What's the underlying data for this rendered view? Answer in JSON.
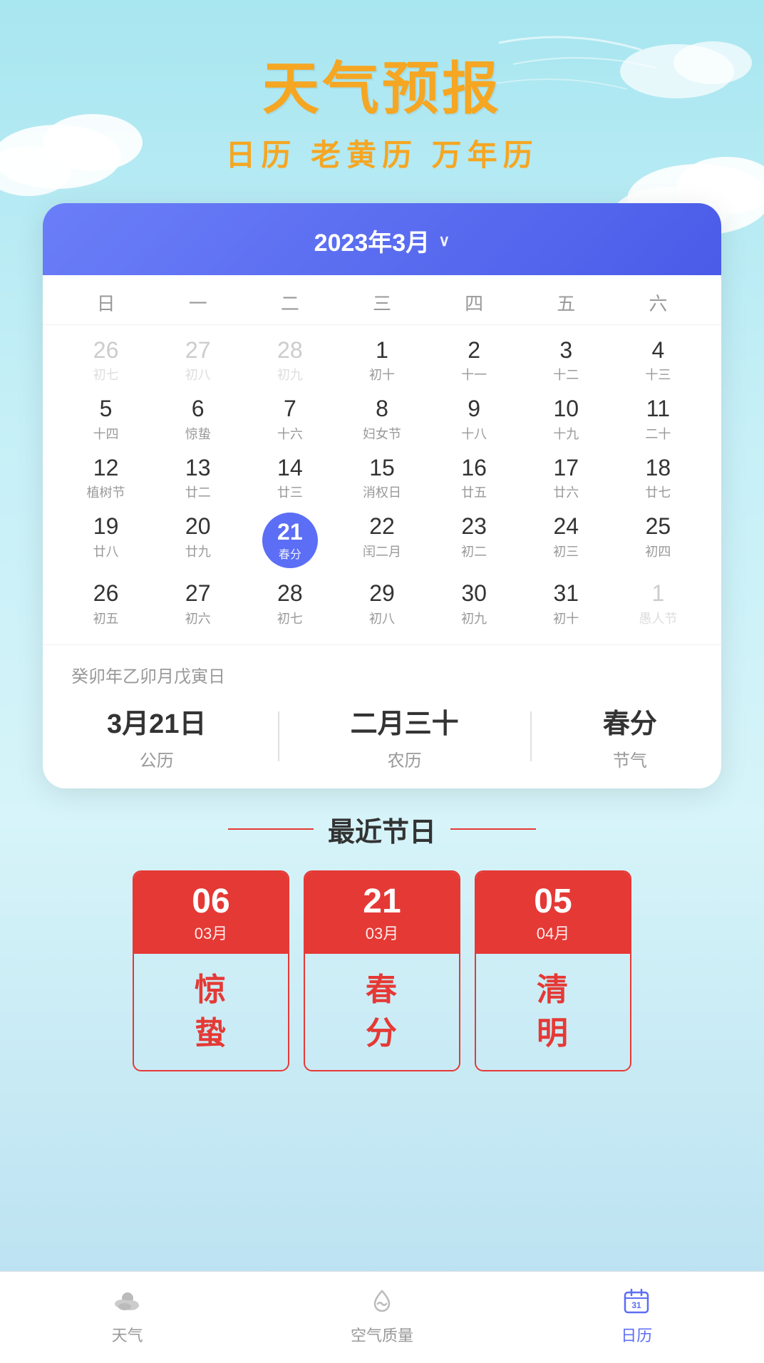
{
  "app": {
    "title": "天气预报",
    "subtitle": "日历 老黄历 万年历"
  },
  "calendar": {
    "month_title": "2023年3月",
    "weekdays": [
      "日",
      "一",
      "二",
      "三",
      "四",
      "五",
      "六"
    ],
    "weeks": [
      [
        {
          "day": "26",
          "sub": "初七",
          "type": "other"
        },
        {
          "day": "27",
          "sub": "初八",
          "type": "other"
        },
        {
          "day": "28",
          "sub": "初九",
          "type": "other"
        },
        {
          "day": "1",
          "sub": "初十",
          "type": "current"
        },
        {
          "day": "2",
          "sub": "十一",
          "type": "current"
        },
        {
          "day": "3",
          "sub": "十二",
          "type": "current"
        },
        {
          "day": "4",
          "sub": "十三",
          "type": "current"
        }
      ],
      [
        {
          "day": "5",
          "sub": "十四",
          "type": "current"
        },
        {
          "day": "6",
          "sub": "惊蛰",
          "type": "current"
        },
        {
          "day": "7",
          "sub": "十六",
          "type": "current"
        },
        {
          "day": "8",
          "sub": "妇女节",
          "type": "current"
        },
        {
          "day": "9",
          "sub": "十八",
          "type": "current"
        },
        {
          "day": "10",
          "sub": "十九",
          "type": "current"
        },
        {
          "day": "11",
          "sub": "二十",
          "type": "current"
        }
      ],
      [
        {
          "day": "12",
          "sub": "植树节",
          "type": "current"
        },
        {
          "day": "13",
          "sub": "廿二",
          "type": "current"
        },
        {
          "day": "14",
          "sub": "廿三",
          "type": "current"
        },
        {
          "day": "15",
          "sub": "消权日",
          "type": "current"
        },
        {
          "day": "16",
          "sub": "廿五",
          "type": "current"
        },
        {
          "day": "17",
          "sub": "廿六",
          "type": "current"
        },
        {
          "day": "18",
          "sub": "廿七",
          "type": "current"
        }
      ],
      [
        {
          "day": "19",
          "sub": "廿八",
          "type": "current"
        },
        {
          "day": "20",
          "sub": "廿九",
          "type": "current"
        },
        {
          "day": "21",
          "sub": "春分",
          "type": "today"
        },
        {
          "day": "22",
          "sub": "闰二月",
          "type": "current"
        },
        {
          "day": "23",
          "sub": "初二",
          "type": "current"
        },
        {
          "day": "24",
          "sub": "初三",
          "type": "current"
        },
        {
          "day": "25",
          "sub": "初四",
          "type": "current"
        }
      ],
      [
        {
          "day": "26",
          "sub": "初五",
          "type": "current"
        },
        {
          "day": "27",
          "sub": "初六",
          "type": "current"
        },
        {
          "day": "28",
          "sub": "初七",
          "type": "current"
        },
        {
          "day": "29",
          "sub": "初八",
          "type": "current"
        },
        {
          "day": "30",
          "sub": "初九",
          "type": "current"
        },
        {
          "day": "31",
          "sub": "初十",
          "type": "current"
        },
        {
          "day": "1",
          "sub": "愚人节",
          "type": "other"
        }
      ]
    ]
  },
  "selected_date": {
    "ganzhi": "癸卯年乙卯月戊寅日",
    "solar": "3月21日",
    "solar_label": "公历",
    "lunar": "二月三十",
    "lunar_label": "农历",
    "jieqi": "春分",
    "jieqi_label": "节气"
  },
  "holidays_section": {
    "title": "最近节日",
    "items": [
      {
        "day": "06",
        "month": "03月",
        "name": "惊\n蛰"
      },
      {
        "day": "21",
        "month": "03月",
        "name": "春\n分"
      },
      {
        "day": "05",
        "month": "04月",
        "name": "清\n明"
      }
    ]
  },
  "bottom_nav": {
    "items": [
      {
        "label": "天气",
        "icon": "🌤",
        "active": false
      },
      {
        "label": "空气质量",
        "icon": "🌀",
        "active": false
      },
      {
        "label": "日历",
        "icon": "📅",
        "active": true
      }
    ]
  }
}
